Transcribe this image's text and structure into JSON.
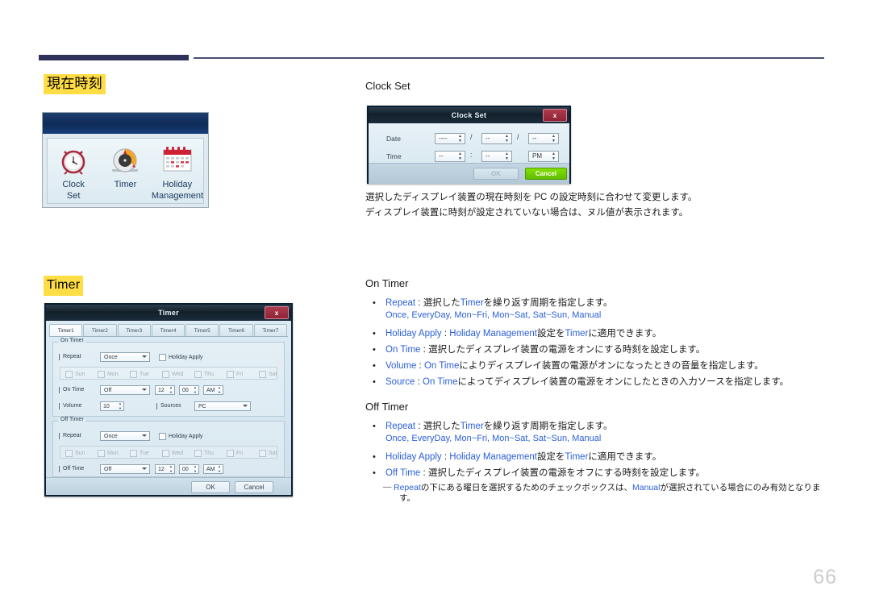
{
  "page": {
    "number": "66"
  },
  "sections": {
    "clock_heading": "現在時刻",
    "timer_heading": "Timer"
  },
  "icon_panel": {
    "items": [
      {
        "icon": "alarm-clock-icon",
        "label_line1": "Clock",
        "label_line2": "Set"
      },
      {
        "icon": "kitchen-timer-icon",
        "label_line1": "Timer",
        "label_line2": ""
      },
      {
        "icon": "calendar-icon",
        "label_line1": "Holiday",
        "label_line2": "Management"
      }
    ]
  },
  "clock_set": {
    "title": "Clock Set",
    "dialog": {
      "title": "Clock Set",
      "close_label": "x",
      "date_label": "Date",
      "time_label": "Time",
      "date_year": "----",
      "date_month": "--",
      "date_day": "--",
      "date_sep1": "/",
      "date_sep2": "/",
      "time_hour": "--",
      "time_minute": "--",
      "time_ampm": "PM",
      "time_sep": ":",
      "ok_label": "OK",
      "cancel_label": "Cancel"
    },
    "description_line1": "選択したディスプレイ装置の現在時刻を PC の設定時刻に合わせて変更します。",
    "description_line2": "ディスプレイ装置に時刻が設定されていない場合は、ヌル値が表示されます。"
  },
  "timer_dialog": {
    "title": "Timer",
    "close_label": "x",
    "tabs": [
      "Timer1",
      "Timer2",
      "Timer3",
      "Timer4",
      "Timer5",
      "Timer6",
      "Timer7"
    ],
    "active_tab": "Timer1",
    "on_timer": {
      "legend": "On Timer",
      "repeat_label": "Repeat",
      "repeat_value": "Once",
      "holiday_apply_label": "Holiday Apply",
      "days": [
        "Sun",
        "Mon",
        "Tue",
        "Wed",
        "Thu",
        "Fri",
        "Sat"
      ],
      "on_time_label": "On Time",
      "on_time_value": "Off",
      "on_time_hour": "12",
      "on_time_minute": "00",
      "on_time_ampm": "AM",
      "volume_label": "Volume",
      "volume_value": "10",
      "sources_label": "Sources",
      "sources_value": "PC"
    },
    "off_timer": {
      "legend": "Off Timer",
      "repeat_label": "Repeat",
      "repeat_value": "Once",
      "holiday_apply_label": "Holiday Apply",
      "days": [
        "Sun",
        "Mon",
        "Tue",
        "Wed",
        "Thu",
        "Fri",
        "Sat"
      ],
      "off_time_label": "Off Time",
      "off_time_value": "Off",
      "off_time_hour": "12",
      "off_time_minute": "00",
      "off_time_ampm": "AM"
    },
    "ok_label": "OK",
    "cancel_label": "Cancel"
  },
  "on_timer_doc": {
    "title": "On Timer",
    "bullets": [
      {
        "en": "Repeat",
        "sep": " : ",
        "jp": "選択した",
        "mid_en": "Timer",
        "jp_tail": "を繰り返す周期を指定します。",
        "sub": "Once, EveryDay, Mon~Fri, Mon~Sat, Sat~Sun, Manual"
      },
      {
        "en": "Holiday Apply",
        "sep": " : ",
        "en2": "Holiday Management",
        "jp": "設定を",
        "mid_en": "Timer",
        "jp_tail": "に適用できます。"
      },
      {
        "en": "On Time",
        "sep": " : ",
        "jp_tail": "選択したディスプレイ装置の電源をオンにする時刻を設定します。"
      },
      {
        "en": "Volume",
        "sep": " : ",
        "mid_en": "On Time",
        "jp_tail": "によりディスプレイ装置の電源がオンになったときの音量を指定します。"
      },
      {
        "en": "Source",
        "sep": " : ",
        "mid_en": "On Time",
        "jp_tail": "によってディスプレイ装置の電源をオンにしたときの入力ソースを指定します。"
      }
    ]
  },
  "off_timer_doc": {
    "title": "Off Timer",
    "bullets": [
      {
        "en": "Repeat",
        "sep": " : ",
        "jp": "選択した",
        "mid_en": "Timer",
        "jp_tail": "を繰り返す周期を指定します。",
        "sub": "Once, EveryDay, Mon~Fri, Mon~Sat, Sat~Sun, Manual"
      },
      {
        "en": "Holiday Apply",
        "sep": " : ",
        "en2": "Holiday Management",
        "jp": "設定を",
        "mid_en": "Timer",
        "jp_tail": "に適用できます。"
      },
      {
        "en": "Off Time",
        "sep": " : ",
        "jp_tail": "選択したディスプレイ装置の電源をオフにする時刻を設定します。"
      }
    ],
    "note": {
      "dash": "―",
      "en1": "Repeat",
      "jp1": "の下にある曜日を選択するためのチェックボックスは、",
      "en2": "Manual",
      "jp2": "が選択されている場合にのみ有効となりま",
      "jp3": "す。"
    }
  },
  "colors": {
    "highlight": "#ffdd44",
    "rule_dark": "#2e3259",
    "link_blue": "#2b5fd9",
    "page_number": "#cccccc"
  }
}
